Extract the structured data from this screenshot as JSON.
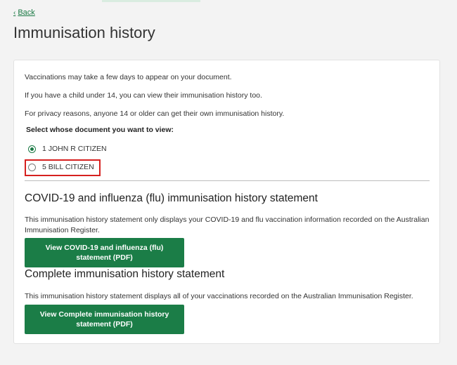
{
  "nav": {
    "back_label": "Back"
  },
  "page": {
    "title": "Immunisation history"
  },
  "info": {
    "line1": "Vaccinations may take a few days to appear on your document.",
    "line2": "If you have a child under 14, you can view their immunisation history too.",
    "line3": "For privacy reasons, anyone 14 or older can get their own immunisation history."
  },
  "selector": {
    "label": "Select whose document you want to view:",
    "options": [
      {
        "label": "1 JOHN R CITIZEN",
        "selected": true
      },
      {
        "label": "5 BILL CITIZEN",
        "selected": false
      }
    ]
  },
  "covid_section": {
    "title": "COVID-19 and influenza (flu) immunisation history statement",
    "description": "This immunisation history statement only displays your COVID-19 and flu vaccination information recorded on the Australian Immunisation Register.",
    "button_label": "View COVID-19 and influenza (flu) statement (PDF)"
  },
  "complete_section": {
    "title": "Complete immunisation history statement",
    "description": "This immunisation history statement displays all of your vaccinations recorded on the Australian Immunisation Register.",
    "button_label": "View Complete immunisation history statement (PDF)"
  },
  "colors": {
    "brand_green": "#1b7d47",
    "highlight_red": "#d6201f",
    "background": "#f3f3f3"
  }
}
